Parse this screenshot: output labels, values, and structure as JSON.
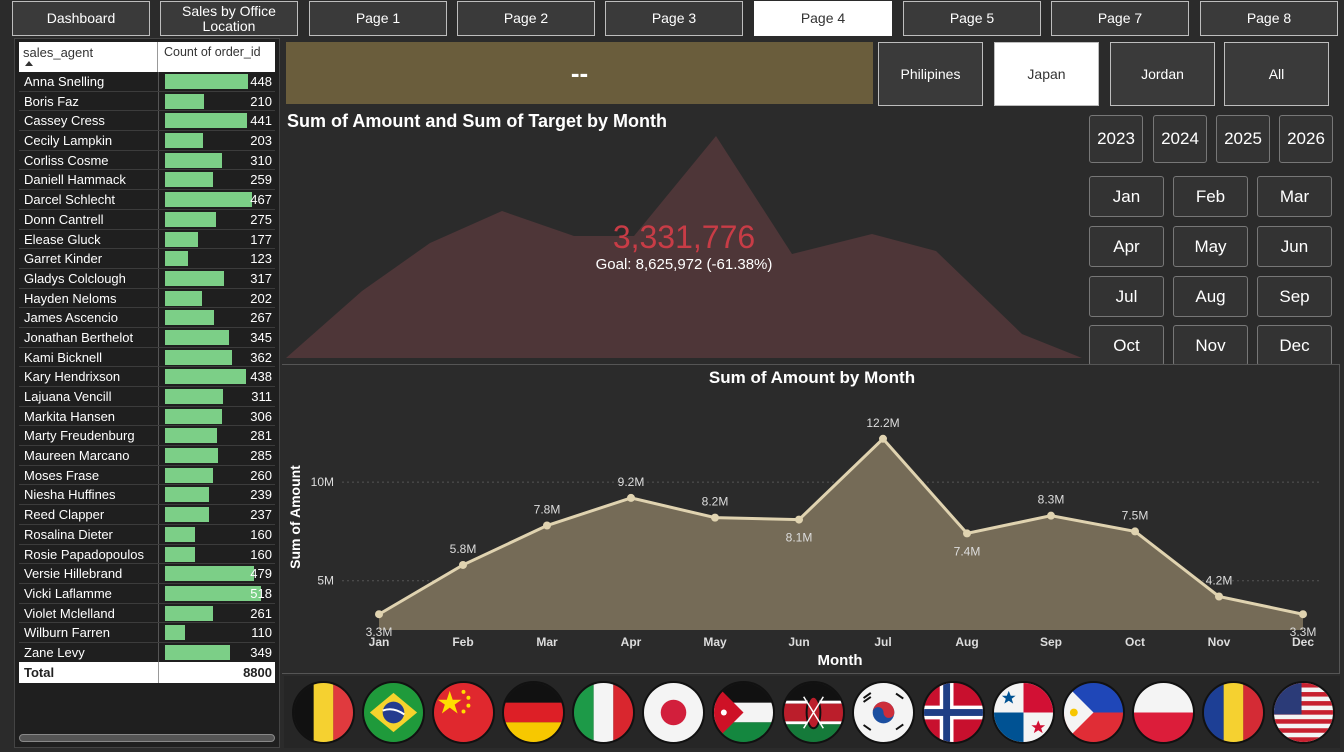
{
  "nav": {
    "items": [
      {
        "label": "Dashboard",
        "active": false
      },
      {
        "label": "Sales by Office Location",
        "active": false
      },
      {
        "label": "Page 1",
        "active": false
      },
      {
        "label": "Page 2",
        "active": false
      },
      {
        "label": "Page 3",
        "active": false
      },
      {
        "label": "Page 4",
        "active": true
      },
      {
        "label": "Page 5",
        "active": false
      },
      {
        "label": "Page 7",
        "active": false
      },
      {
        "label": "Page 8",
        "active": false
      }
    ]
  },
  "table": {
    "col1": "sales_agent",
    "col2": "Count of order_id",
    "max": 518,
    "rows": [
      {
        "name": "Anna Snelling",
        "value": 448
      },
      {
        "name": "Boris Faz",
        "value": 210
      },
      {
        "name": "Cassey Cress",
        "value": 441
      },
      {
        "name": "Cecily Lampkin",
        "value": 203
      },
      {
        "name": "Corliss Cosme",
        "value": 310
      },
      {
        "name": "Daniell Hammack",
        "value": 259
      },
      {
        "name": "Darcel Schlecht",
        "value": 467
      },
      {
        "name": "Donn Cantrell",
        "value": 275
      },
      {
        "name": "Elease Gluck",
        "value": 177
      },
      {
        "name": "Garret Kinder",
        "value": 123
      },
      {
        "name": "Gladys Colclough",
        "value": 317
      },
      {
        "name": "Hayden Neloms",
        "value": 202
      },
      {
        "name": "James Ascencio",
        "value": 267
      },
      {
        "name": "Jonathan Berthelot",
        "value": 345
      },
      {
        "name": "Kami Bicknell",
        "value": 362
      },
      {
        "name": "Kary Hendrixson",
        "value": 438
      },
      {
        "name": "Lajuana Vencill",
        "value": 311
      },
      {
        "name": "Markita Hansen",
        "value": 306
      },
      {
        "name": "Marty Freudenburg",
        "value": 281
      },
      {
        "name": "Maureen Marcano",
        "value": 285
      },
      {
        "name": "Moses Frase",
        "value": 260
      },
      {
        "name": "Niesha Huffines",
        "value": 239
      },
      {
        "name": "Reed Clapper",
        "value": 237
      },
      {
        "name": "Rosalina Dieter",
        "value": 160
      },
      {
        "name": "Rosie Papadopoulos",
        "value": 160
      },
      {
        "name": "Versie Hillebrand",
        "value": 479
      },
      {
        "name": "Vicki Laflamme",
        "value": 518
      },
      {
        "name": "Violet Mclelland",
        "value": 261
      },
      {
        "name": "Wilburn Farren",
        "value": 110
      },
      {
        "name": "Zane Levy",
        "value": 349
      }
    ],
    "total_label": "Total",
    "total_value": "8800"
  },
  "banner": {
    "text": "--"
  },
  "countries": [
    {
      "label": "Philipines",
      "active": false
    },
    {
      "label": "Japan",
      "active": true
    },
    {
      "label": "Jordan",
      "active": false
    },
    {
      "label": "All",
      "active": false
    }
  ],
  "years": [
    "2023",
    "2024",
    "2025",
    "2026"
  ],
  "months": [
    "Jan",
    "Feb",
    "Mar",
    "Apr",
    "May",
    "Jun",
    "Jul",
    "Aug",
    "Sep",
    "Oct",
    "Nov",
    "Dec"
  ],
  "kpi": {
    "title": "Sum of Amount and Sum of Target by Month",
    "value": "3,331,776",
    "goal": "Goal: 8,625,972 (-61.38%)",
    "color": "#c83c46",
    "area_color": "#4e3638"
  },
  "chart_data": {
    "type": "area",
    "title": "Sum of Amount by Month",
    "xlabel": "Month",
    "ylabel": "Sum of Amount",
    "categories": [
      "Jan",
      "Feb",
      "Mar",
      "Apr",
      "May",
      "Jun",
      "Jul",
      "Aug",
      "Sep",
      "Oct",
      "Nov",
      "Dec"
    ],
    "values": [
      3.3,
      5.8,
      7.8,
      9.2,
      8.2,
      8.1,
      12.2,
      7.4,
      8.3,
      7.5,
      4.2,
      3.3
    ],
    "labels": [
      "3.3M",
      "5.8M",
      "7.8M",
      "9.2M",
      "8.2M",
      "8.1M",
      "12.2M",
      "7.4M",
      "8.3M",
      "7.5M",
      "4.2M",
      "3.3M"
    ],
    "yticks": [
      {
        "value": 5,
        "label": "5M"
      },
      {
        "value": 10,
        "label": "10M"
      }
    ],
    "ylim": [
      2.5,
      13
    ],
    "line_color": "#e0d3b0",
    "fill_color": "#756b57"
  },
  "flags": [
    "Belgium",
    "Brazil",
    "China",
    "Germany",
    "Italy",
    "Japan",
    "Jordan",
    "Kenya",
    "South Korea",
    "Norway",
    "Panama",
    "Philippines",
    "Poland",
    "Romania",
    "United States"
  ]
}
